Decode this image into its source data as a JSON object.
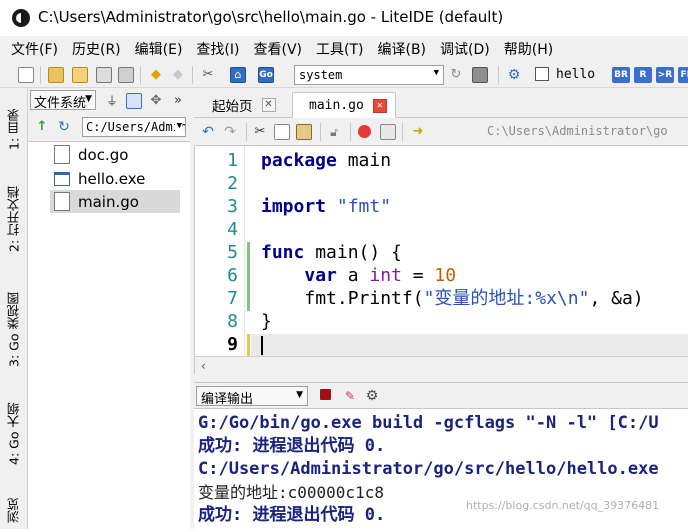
{
  "window": {
    "title": "C:\\Users\\Administrator\\go\\src\\hello\\main.go - LiteIDE (default)"
  },
  "menu": [
    "文件(F)",
    "历史(R)",
    "编辑(E)",
    "查找(I)",
    "查看(V)",
    "工具(T)",
    "编译(B)",
    "调试(D)",
    "帮助(H)"
  ],
  "toolbar": {
    "build_env": "system",
    "hello_checkbox_label": "hello",
    "text_buttons": [
      "BR",
      "R",
      ">R",
      "FR"
    ]
  },
  "side_tabs": [
    "1: 目录",
    "2: 打开文档",
    "3: Go 类视图",
    "4: Go 大纲",
    "浏览"
  ],
  "file_pane": {
    "mode": "文件系统",
    "path": "C:/Users/Administrator",
    "files": [
      {
        "name": "doc.go",
        "icon": "go-file-icon",
        "selected": false
      },
      {
        "name": "hello.exe",
        "icon": "exe-file-icon",
        "selected": false
      },
      {
        "name": "main.go",
        "icon": "go-file-icon",
        "selected": true
      }
    ]
  },
  "editor": {
    "tabs": [
      {
        "label": "起始页",
        "active": false
      },
      {
        "label": "main.go",
        "active": true
      }
    ],
    "path_display": "C:\\Users\\Administrator\\go",
    "line_numbers": [
      "1",
      "2",
      "3",
      "4",
      "5",
      "6",
      "7",
      "8",
      "9"
    ],
    "current_line": 9,
    "code": {
      "l1_kw": "package",
      "l1_rest": " main",
      "l3_kw": "import",
      "l3_str": " \"fmt\"",
      "l5_kw": "func",
      "l5_rest": " main() {",
      "l6_indent": "    ",
      "l6_kw": "var",
      "l6_mid": " a ",
      "l6_type": "int",
      "l6_eq": " = ",
      "l6_num": "10",
      "l7_indent": "    ",
      "l7_call": "fmt.Printf(",
      "l7_str": "\"变量的地址:%x\\n\"",
      "l7_rest": ", &a)",
      "l8": "}"
    }
  },
  "output": {
    "panel_select": "编译输出",
    "lines": [
      "G:/Go/bin/go.exe build -gcflags \"-N -l\" [C:/U",
      "成功: 进程退出代码 0.",
      "C:/Users/Administrator/go/src/hello/hello.exe",
      "变量的地址:c00000c1c8",
      "成功: 进程退出代码 0."
    ]
  },
  "watermark": "https://blog.csdn.net/qq_39376481",
  "colors": {
    "keyword": "#00008b",
    "string": "#2a52be",
    "number": "#c06000",
    "line_number": "#1e8c8c",
    "output_text": "#1a237e",
    "active_tab_close": "#e84a3a"
  }
}
